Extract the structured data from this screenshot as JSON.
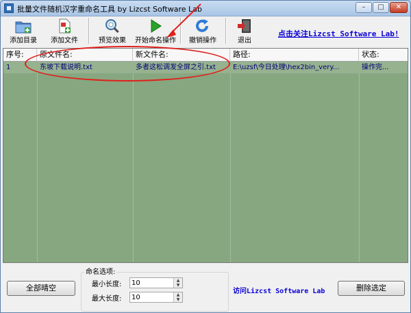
{
  "window": {
    "title": "批量文件随机汉字重命名工具  by Lizcst Software Lab"
  },
  "toolbar": {
    "add_dir": "添加目录",
    "add_file": "添加文件",
    "preview": "预览效果",
    "start": "开始命名操作",
    "undo": "撤销操作",
    "exit": "退出",
    "follow_link": "点击关注Lizcst Software Lab!"
  },
  "table": {
    "columns": [
      "序号:",
      "原文件名:",
      "新文件名:",
      "路径:",
      "状态:"
    ],
    "rows": [
      {
        "index": "1",
        "original": "东坡下载说明.txt",
        "new": "多者这松调发全屏之引.txt",
        "path": "E:\\uzsf\\今日处理\\hex2bin_very...",
        "status": "操作完..."
      }
    ]
  },
  "bottom": {
    "clear_all": "全部晴空",
    "options_title": "命名选项:",
    "min_label": "最小长度:",
    "min_value": "10",
    "max_label": "最大长度:",
    "max_value": "10",
    "visit_link": "访问Lizcst Software Lab",
    "delete_selected": "删除选定"
  },
  "colors": {
    "grid_bg": "#87a781",
    "annotation_red": "#e0201c",
    "link_blue": "#0a00d6"
  },
  "icons": [
    "app-icon",
    "folder-add-icon",
    "file-add-icon",
    "magnifier-icon",
    "play-icon",
    "undo-icon",
    "exit-door-icon"
  ]
}
